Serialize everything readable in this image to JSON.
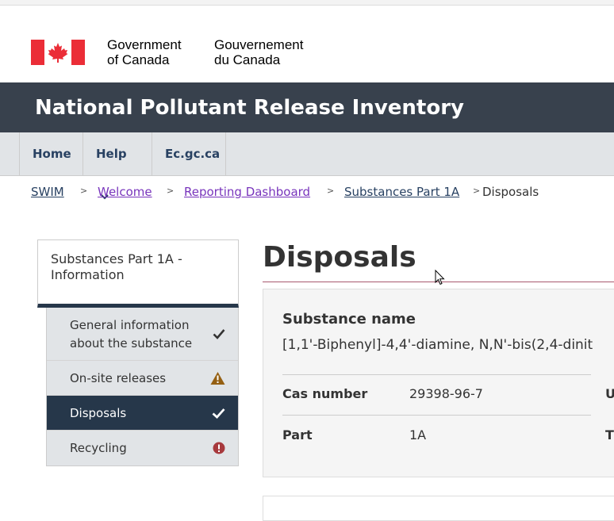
{
  "header": {
    "sig_en_line1": "Government",
    "sig_en_line2": "of Canada",
    "sig_fr_line1": "Gouvernement",
    "sig_fr_line2": "du Canada",
    "flag_icon": "canada-flag-icon",
    "flag_color": "#eb2d37"
  },
  "app": {
    "title": "National Pollutant Release Inventory",
    "bar_color": "#38414d"
  },
  "menu": {
    "items": [
      {
        "label": "Home"
      },
      {
        "label": "Help",
        "icon": "chevron-down-icon"
      },
      {
        "label": "Ec.gc.ca"
      }
    ]
  },
  "breadcrumb": {
    "items": [
      "SWIM",
      "Welcome",
      "Reporting Dashboard",
      "Substances Part 1A"
    ],
    "separator": ">",
    "current": "Disposals"
  },
  "sidebar": {
    "heading": "Substances Part 1A - Information",
    "items": [
      {
        "label": "General information about the substance",
        "status_icon": "check-icon",
        "status_color": "#333333"
      },
      {
        "label": "On-site releases",
        "status_icon": "warning-icon",
        "status_color": "#956013"
      },
      {
        "label": "Disposals",
        "status_icon": "check-icon",
        "status_color": "#ffffff",
        "active": true
      },
      {
        "label": "Recycling",
        "status_icon": "error-icon",
        "status_color": "#a7393d"
      }
    ]
  },
  "page": {
    "title": "Disposals"
  },
  "substance": {
    "name_label": "Substance name",
    "name_value": "[1,1'-Biphenyl]-4,4'-diamine, N,N'-bis(2,4-dinit",
    "cas_label": "Cas number",
    "cas_value": "29398-96-7",
    "part_label": "Part",
    "part_value": "1A",
    "col3_row1_label": "U",
    "col3_row2_label": "T"
  }
}
